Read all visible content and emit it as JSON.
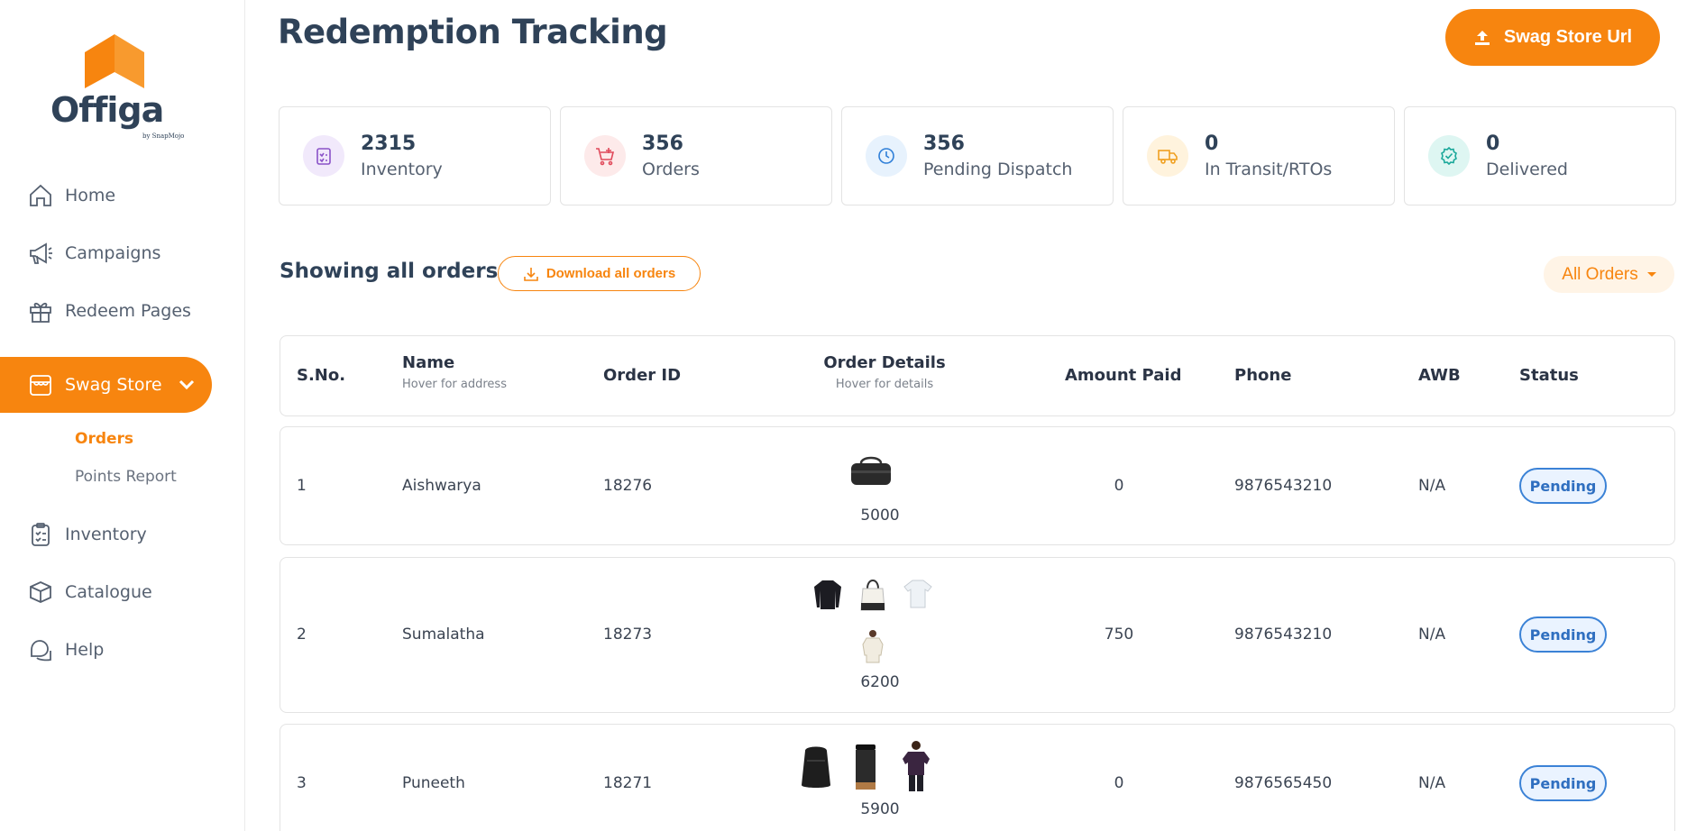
{
  "brand": {
    "name": "Offiga",
    "byline": "by SnapMojo",
    "accent": "#f7850f",
    "primary_text": "#2f4258"
  },
  "sidebar": {
    "items": [
      {
        "label": "Home",
        "icon": "home-icon"
      },
      {
        "label": "Campaigns",
        "icon": "megaphone-icon"
      },
      {
        "label": "Redeem Pages",
        "icon": "gift-icon"
      },
      {
        "label": "Swag Store",
        "icon": "store-icon",
        "active": true
      },
      {
        "label": "Inventory",
        "icon": "clipboard-icon"
      },
      {
        "label": "Catalogue",
        "icon": "box-icon"
      },
      {
        "label": "Help",
        "icon": "chat-icon"
      }
    ],
    "sub_items": [
      {
        "label": "Orders",
        "selected": true
      },
      {
        "label": "Points Report",
        "selected": false
      }
    ]
  },
  "header": {
    "title": "Redemption Tracking",
    "store_button": "Swag Store Url"
  },
  "stats": [
    {
      "value": "2315",
      "label": "Inventory",
      "icon": "clipboard-icon",
      "color": "#f1e9fb"
    },
    {
      "value": "356",
      "label": "Orders",
      "icon": "cart-icon",
      "color": "#fdeaea"
    },
    {
      "value": "356",
      "label": "Pending Dispatch",
      "icon": "clock-icon",
      "color": "#e7f2fd"
    },
    {
      "value": "0",
      "label": "In Transit/RTOs",
      "icon": "truck-icon",
      "color": "#fff3dd"
    },
    {
      "value": "0",
      "label": "Delivered",
      "icon": "check-circle-icon",
      "color": "#def6f2"
    }
  ],
  "orders": {
    "heading": "Showing all orders",
    "download_label": "Download all orders",
    "filter_label": "All Orders",
    "columns": {
      "sno": "S.No.",
      "name": "Name",
      "name_hint": "Hover for address",
      "order_id": "Order ID",
      "details": "Order Details",
      "details_hint": "Hover for details",
      "amount": "Amount Paid",
      "phone": "Phone",
      "awb": "AWB",
      "status": "Status"
    },
    "rows": [
      {
        "sno": "1",
        "name": "Aishwarya",
        "order_id": "18276",
        "points": "5000",
        "items": [
          "duffel-bag"
        ],
        "amount": "0",
        "phone": "9876543210",
        "awb": "N/A",
        "status": "Pending"
      },
      {
        "sno": "2",
        "name": "Sumalatha",
        "order_id": "18273",
        "points": "6200",
        "items": [
          "sweatshirt",
          "tote-bag",
          "tshirt",
          "shirt"
        ],
        "amount": "750",
        "phone": "9876543210",
        "awb": "N/A",
        "status": "Pending"
      },
      {
        "sno": "3",
        "name": "Puneeth",
        "order_id": "18271",
        "points": "5900",
        "items": [
          "backpack",
          "tumbler",
          "tshirt-model"
        ],
        "amount": "0",
        "phone": "9876565450",
        "awb": "N/A",
        "status": "Pending"
      }
    ]
  }
}
